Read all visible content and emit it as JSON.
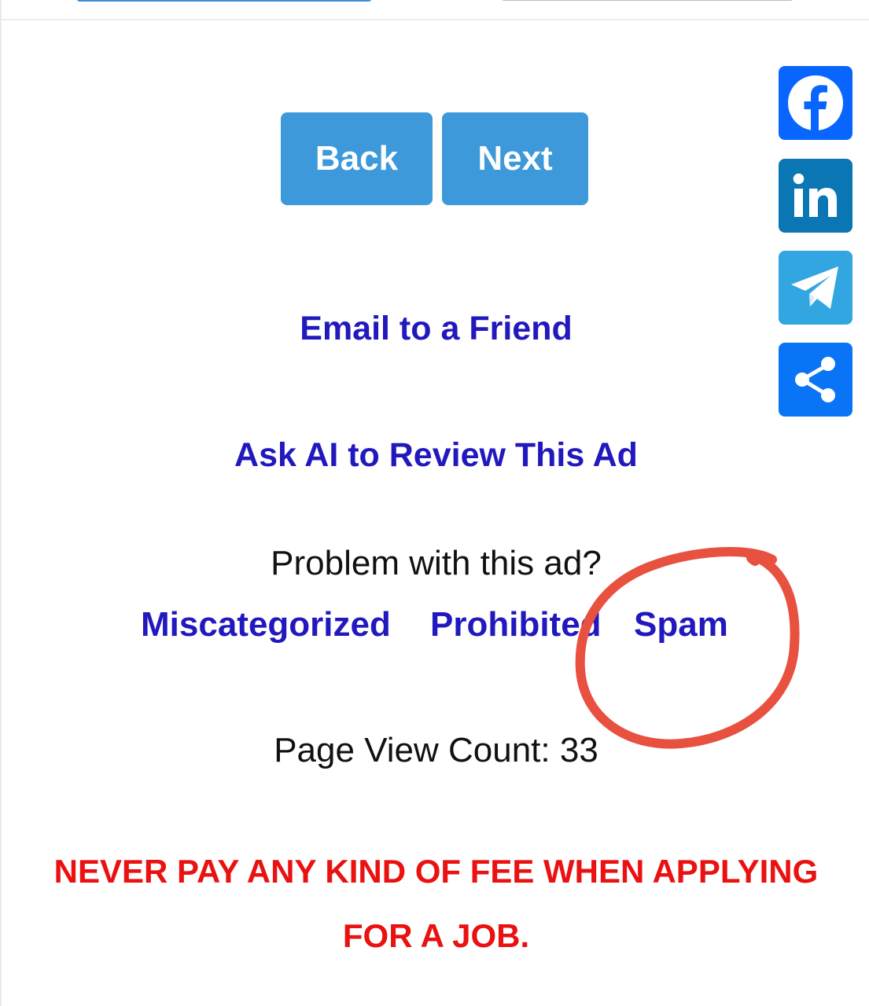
{
  "navigation": {
    "back_label": "Back",
    "next_label": "Next"
  },
  "links": {
    "email_friend": "Email to a Friend",
    "ask_ai": "Ask AI to Review This Ad"
  },
  "report": {
    "prompt": "Problem with this ad?",
    "options": [
      "Miscategorized",
      "Prohibited",
      "Spam"
    ]
  },
  "stats": {
    "page_view_count": "Page View Count: 33"
  },
  "warning": {
    "text": "NEVER PAY ANY KIND OF FEE WHEN APPLYING FOR A JOB."
  },
  "share_bar": {
    "buttons": [
      "facebook-icon",
      "linkedin-icon",
      "telegram-icon",
      "share-icon"
    ],
    "colors": {
      "facebook": "#0866ff",
      "linkedin": "#0a76b4",
      "telegram": "#32a6e0",
      "share": "#0a74f7"
    }
  },
  "theme": {
    "button_blue": "#3d99da",
    "link_color": "#2118bd",
    "warning_red": "#ea1111",
    "annotation_red": "#e8503f"
  }
}
